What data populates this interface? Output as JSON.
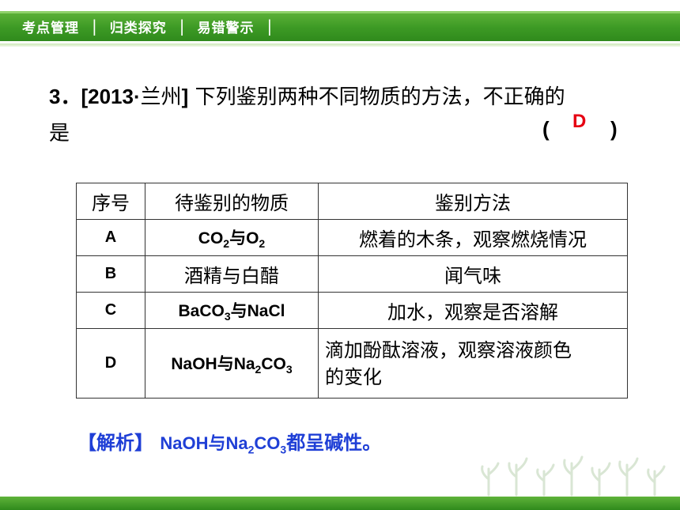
{
  "nav": {
    "items": [
      "考点管理",
      "归类探究",
      "易错警示"
    ],
    "separator": "|"
  },
  "question": {
    "number": "3．",
    "source_year": "[2013·",
    "source_place": "兰州",
    "source_end": "]",
    "text_line1": " 下列鉴别两种不同物质的方法，不正确的",
    "text_line2": "是",
    "paren_open": "(",
    "answer": "D",
    "paren_close": ")"
  },
  "table": {
    "headers": [
      "序号",
      "待鉴别的物质",
      "鉴别方法"
    ],
    "rows": [
      {
        "id": "A",
        "substance": [
          "CO",
          "2",
          "与O",
          "2"
        ],
        "method": "燃着的木条，观察燃烧情况"
      },
      {
        "id": "B",
        "substance_text": "酒精与白醋",
        "method": "闻气味"
      },
      {
        "id": "C",
        "substance": [
          "BaCO",
          "3",
          "与NaCl"
        ],
        "method": "加水，观察是否溶解"
      },
      {
        "id": "D",
        "substance": [
          "NaOH与Na",
          "2",
          "CO",
          "3"
        ],
        "method_line1": "滴加酚酞溶液，观察溶液颜色",
        "method_line2": "的变化"
      }
    ]
  },
  "analysis": {
    "label": "【解析】",
    "text_a": "NaOH与Na",
    "sub_a": "2",
    "text_b": "CO",
    "sub_b": "3",
    "text_c": "都呈碱性。"
  },
  "colors": {
    "nav_green": "#3d9a25",
    "answer_red": "#e60012",
    "analysis_blue": "#1f3fd6"
  }
}
